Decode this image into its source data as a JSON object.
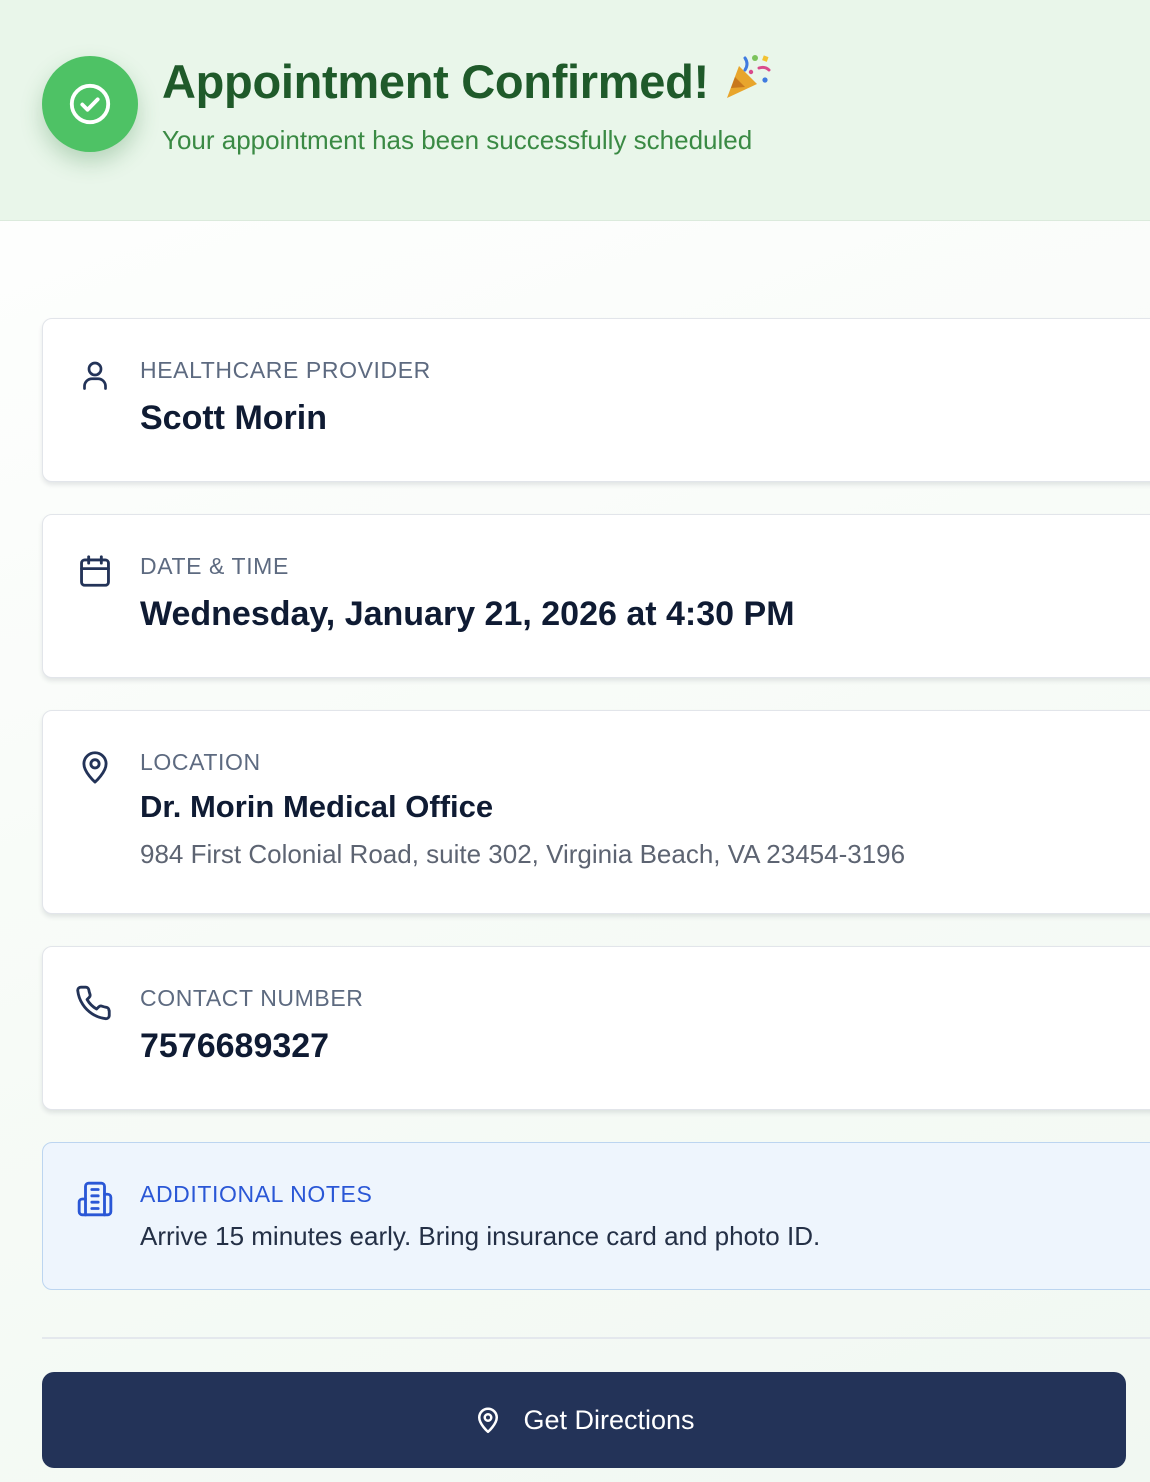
{
  "header": {
    "title": "Appointment Confirmed!",
    "emoji": "🎉",
    "subtitle": "Your appointment has been successfully scheduled",
    "success_color": "#4ec265"
  },
  "provider": {
    "icon": "user-icon",
    "label": "HEALTHCARE PROVIDER",
    "value": "Scott Morin"
  },
  "datetime": {
    "icon": "calendar-icon",
    "label": "DATE & TIME",
    "value": "Wednesday, January 21, 2026 at 4:30 PM"
  },
  "location": {
    "icon": "map-pin-icon",
    "label": "LOCATION",
    "name": "Dr. Morin Medical Office",
    "address": "984 First Colonial Road, suite 302, Virginia Beach, VA 23454-3196"
  },
  "contact": {
    "icon": "phone-icon",
    "label": "CONTACT NUMBER",
    "value": "7576689327"
  },
  "notes": {
    "icon": "building-icon",
    "label": "ADDITIONAL NOTES",
    "text": "Arrive 15 minutes early. Bring insurance card and photo ID.",
    "accent_color": "#2a57d6"
  },
  "actions": {
    "directions_label": "Get Directions",
    "button_color": "#233358"
  }
}
